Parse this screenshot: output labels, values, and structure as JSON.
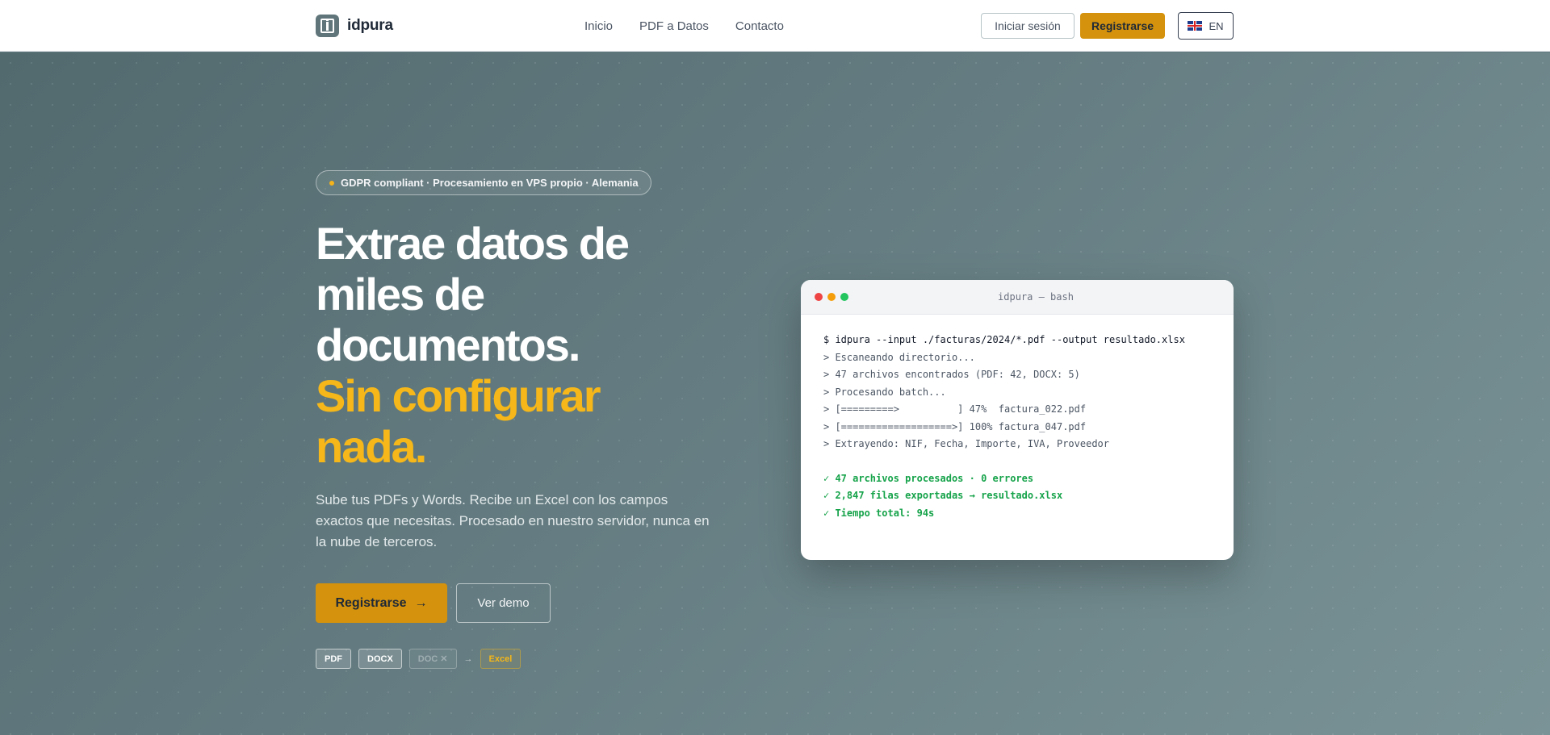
{
  "brand": {
    "name": "idpura"
  },
  "nav": {
    "links": [
      "Inicio",
      "PDF a Datos",
      "Contacto"
    ],
    "login_label": "Iniciar sesión",
    "register_label": "Registrarse",
    "lang_label": "EN"
  },
  "hero": {
    "badge": "GDPR compliant · Procesamiento en VPS propio · Alemania",
    "title_lines": [
      "Extrae datos de",
      "miles de",
      "documentos."
    ],
    "title_accent_lines": [
      "Sin configurar",
      "nada."
    ],
    "subtitle": "Sube tus PDFs y Words. Recibe un Excel con los campos exactos que necesitas. Procesado en nuestro servidor, nunca en la nube de terceros.",
    "cta_label": "Registrarse",
    "cta_arrow": "→",
    "demo_label": "Ver demo",
    "formats": [
      "PDF",
      "DOCX",
      "DOC ✕"
    ],
    "format_arrow": "→",
    "format_output": "Excel"
  },
  "terminal": {
    "title": "idpura — bash",
    "command": "$ idpura --input ./facturas/2024/*.pdf --output resultado.xlsx",
    "log": [
      "> Escaneando directorio...",
      "> 47 archivos encontrados (PDF: 42, DOCX: 5)",
      "> Procesando batch...",
      "> [=========>          ] 47%  factura_022.pdf",
      "> [===================>] 100% factura_047.pdf",
      "> Extrayendo: NIF, Fecha, Importe, IVA, Proveedor"
    ],
    "results": [
      "✓ 47 archivos procesados · 0 errores",
      "✓ 2,847 filas exportadas → resultado.xlsx",
      "✓ Tiempo total: 94s"
    ]
  },
  "colors": {
    "accent": "#d4920d",
    "accent_text": "#f5b719",
    "hero_bg": "#5d777b",
    "success": "#16a34a"
  }
}
